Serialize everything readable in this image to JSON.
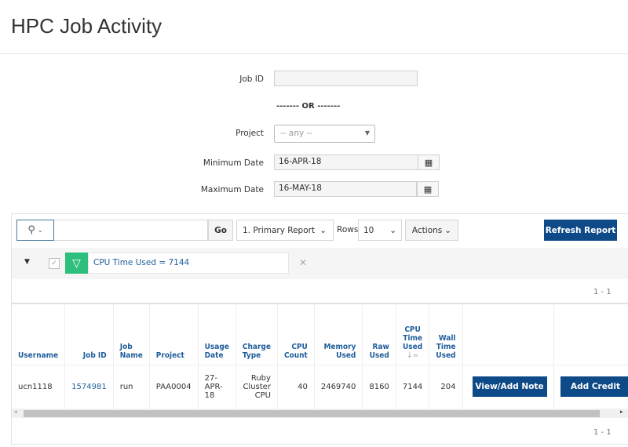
{
  "page": {
    "title": "HPC Job Activity"
  },
  "form": {
    "job_id_label": "Job ID",
    "job_id_value": "",
    "or_text": "------- OR -------",
    "project_label": "Project",
    "project_value": "-- any --",
    "min_date_label": "Minimum Date",
    "min_date_value": "16-APR-18",
    "max_date_label": "Maximum Date",
    "max_date_value": "16-MAY-18"
  },
  "toolbar": {
    "search_value": "",
    "go_label": "Go",
    "report_value": "1. Primary Report",
    "rows_label": "Rows",
    "rows_value": "10",
    "actions_label": "Actions",
    "refresh_label": "Refresh Report"
  },
  "filter": {
    "text": "CPU Time Used = 7144",
    "filter_color": "#2ebf7c"
  },
  "pagination": {
    "top": "1 - 1",
    "bottom": "1 - 1"
  },
  "table": {
    "headers": [
      "Username",
      "Job ID",
      "Job Name",
      "Project",
      "Usage Date",
      "Charge Type",
      "CPU Count",
      "Memory Used",
      "Raw Used",
      "CPU Time Used",
      "Wall Time Used",
      "",
      ""
    ],
    "rows": [
      {
        "username": "ucn1118",
        "job_id": "1574981",
        "job_name": "run",
        "project": "PAA0004",
        "usage_date": "27-APR-18",
        "charge_type": "Ruby Cluster CPU",
        "cpu_count": "40",
        "memory_used": "2469740",
        "raw_used": "8160",
        "cpu_time_used": "7144",
        "wall_time_used": "204",
        "note_button": "View/Add Note",
        "credit_button": "Add Credit"
      }
    ]
  }
}
